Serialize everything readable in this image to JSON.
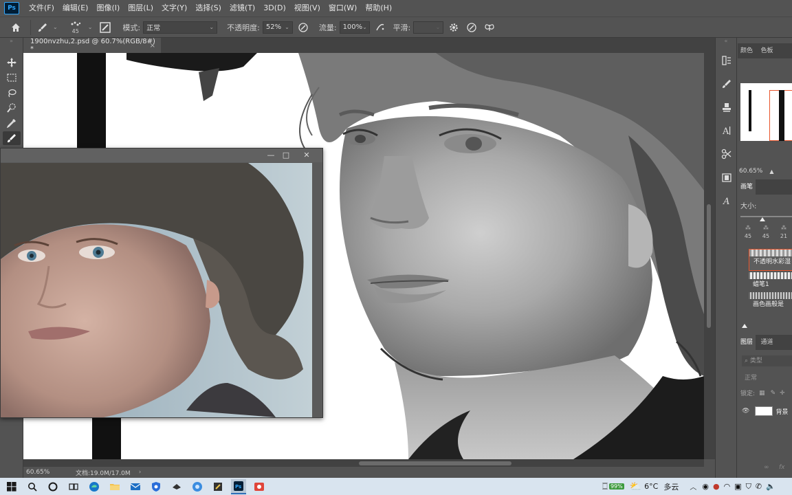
{
  "app": {
    "logo": "Ps",
    "menu": [
      "文件(F)",
      "编辑(E)",
      "图像(I)",
      "图层(L)",
      "文字(Y)",
      "选择(S)",
      "滤镜(T)",
      "3D(D)",
      "视图(V)",
      "窗口(W)",
      "帮助(H)"
    ]
  },
  "options": {
    "brush_size": "45",
    "mode_label": "模式:",
    "mode_value": "正常",
    "opacity_label": "不透明度:",
    "opacity_value": "52%",
    "flow_label": "流量:",
    "flow_value": "100%",
    "smoothing_label": "平滑:",
    "smoothing_value": ""
  },
  "document": {
    "tab_title": "1900nvzhu,2.psd @ 60.7%(RGB/8#) *",
    "close_glyph": "×"
  },
  "status": {
    "zoom": "60.65%",
    "doc_info": "文档:19.0M/17.0M"
  },
  "panels": {
    "color_tabs": [
      "颜色",
      "色板"
    ],
    "navigator_zoom": "60.65%",
    "brush_tab": "画笔",
    "size_label": "大小:",
    "preset_sizes": [
      "45",
      "45",
      "21"
    ],
    "brush_names": [
      "不透明水彩湿",
      "蜡笔1",
      "画色画般是"
    ],
    "layers_tabs": [
      "图层",
      "通道"
    ],
    "layers_kind": "类型",
    "layers_blend": "正常",
    "layers_lock": "锁定:",
    "layer_name": "背景",
    "footer_fx": "fx",
    "footer_link": "∞"
  },
  "taskbar": {
    "battery": "99%",
    "weather_temp": "6°C",
    "weather_desc": "多云"
  },
  "colors": {
    "ui_bg": "#535353",
    "panel_dark": "#424242",
    "accent": "#31a8ff",
    "taskbar": "#d9e4ef"
  }
}
